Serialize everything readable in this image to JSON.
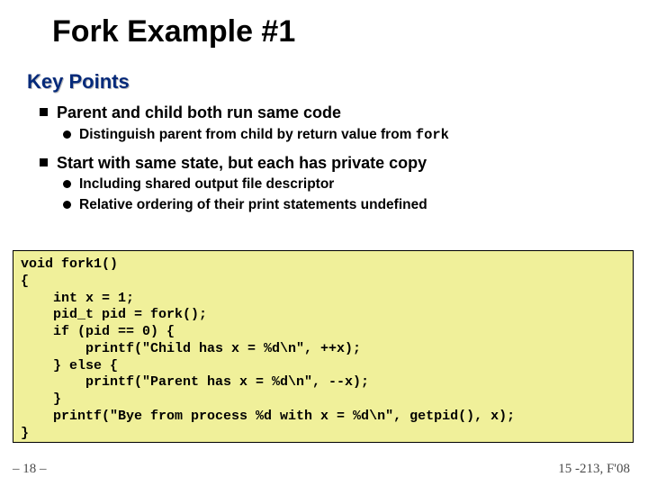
{
  "title": "Fork Example #1",
  "subhead": "Key Points",
  "bullets": [
    {
      "text": "Parent and child both run same code",
      "children": [
        {
          "prefix": "Distinguish parent from child by return value from ",
          "mono": "fork"
        }
      ]
    },
    {
      "text": "Start with same state, but each has private copy",
      "children": [
        {
          "prefix": "Including shared output file descriptor"
        },
        {
          "prefix": "Relative ordering of their print statements undefined"
        }
      ]
    }
  ],
  "code": "void fork1()\n{\n    int x = 1;\n    pid_t pid = fork();\n    if (pid == 0) {\n        printf(\"Child has x = %d\\n\", ++x);\n    } else {\n        printf(\"Parent has x = %d\\n\", --x);\n    }\n    printf(\"Bye from process %d with x = %d\\n\", getpid(), x);\n}",
  "footer": {
    "left": "– 18 –",
    "right": "15 -213, F'08"
  }
}
